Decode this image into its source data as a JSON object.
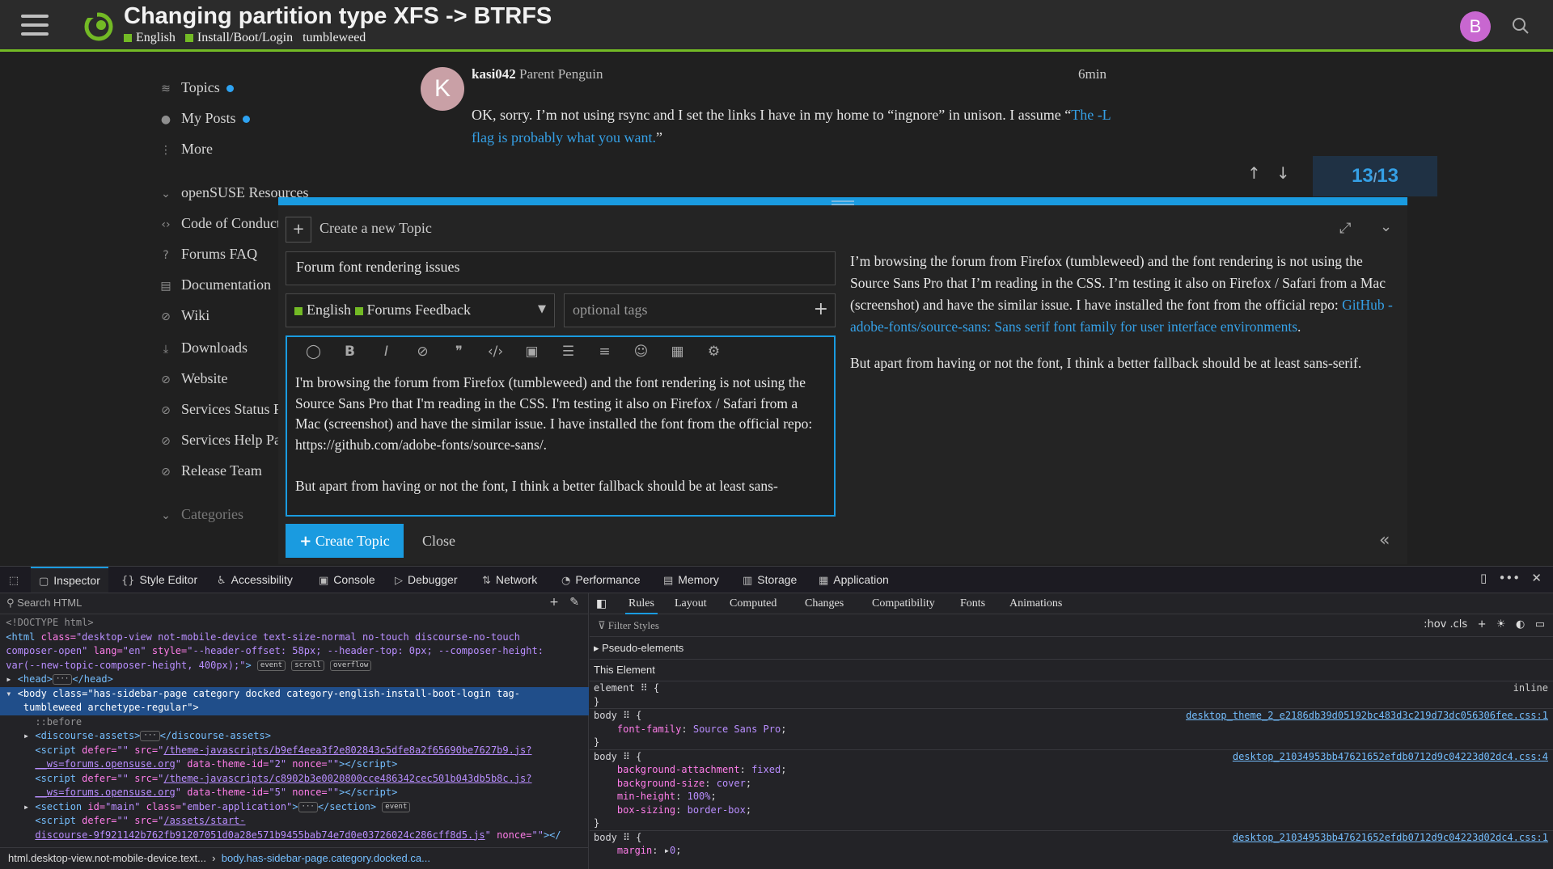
{
  "header": {
    "title": "Changing partition type XFS -> BTRFS",
    "breadcrumb": [
      "English",
      "Install/Boot/Login",
      "tumbleweed"
    ],
    "avatar_letter": "B",
    "accent_color": "#73ba25"
  },
  "sidebar": {
    "items": [
      {
        "icon": "layers-icon",
        "label": "Topics",
        "dot": true
      },
      {
        "icon": "user-icon",
        "label": "My Posts",
        "dot": true
      },
      {
        "icon": "more-icon",
        "label": "More"
      },
      {
        "icon": "chevron-down-icon",
        "label": "openSUSE Resources"
      },
      {
        "icon": "code-icon",
        "label": "Code of Conduct"
      },
      {
        "icon": "question-icon",
        "label": "Forums FAQ"
      },
      {
        "icon": "book-icon",
        "label": "Documentation"
      },
      {
        "icon": "link-icon",
        "label": "Wiki"
      },
      {
        "icon": "download-icon",
        "label": "Downloads"
      },
      {
        "icon": "link-icon",
        "label": "Website"
      },
      {
        "icon": "link-icon",
        "label": "Services Status Page"
      },
      {
        "icon": "link-icon",
        "label": "Services Help Page"
      },
      {
        "icon": "link-icon",
        "label": "Release Team"
      },
      {
        "icon": "chevron-down-icon",
        "label": "Categories"
      }
    ]
  },
  "post": {
    "avatar_letter": "K",
    "username": "kasi042",
    "user_title": "Parent Penguin",
    "time": "6min",
    "text_before": "OK, sorry. I’m not using rsync and I set the links I have in my home to “ingnore” in unison. I assume “",
    "link_text": "The -L flag is probably what you want.",
    "text_after": "”"
  },
  "progress": {
    "current": "13",
    "separator": "/",
    "total": "13"
  },
  "composer": {
    "new_topic_label": "Create a new Topic",
    "title_value": "Forum font rendering issues",
    "category_locale": "English",
    "category_name": "Forums Feedback",
    "tags_placeholder": "optional tags",
    "editor_text": "I'm browsing the forum from Firefox (tumbleweed) and the font rendering is not using the Source Sans Pro that I'm reading in the CSS. I'm testing it also on Firefox / Safari from a Mac (screenshot) and have the similar issue. I have installed the font from the official repo:\nhttps://github.com/adobe-fonts/source-sans/.\n\nBut apart from having or not the font, I think a better fallback should be at least sans-",
    "preview_p1": "I’m browsing the forum from Firefox (tumbleweed) and the font rendering is not using the Source Sans Pro that I’m reading in the CSS. I’m testing it also on Firefox / Safari from a Mac (screenshot) and have the similar issue. I have installed the font from the official repo: ",
    "preview_link": "GitHub - adobe-fonts/source-sans: Sans serif font family for user interface environments",
    "preview_p1_end": ".",
    "preview_p2": "But apart from having or not the font, I think a better fallback should be at least sans-serif.",
    "create_label": "Create Topic",
    "close_label": "Close",
    "accent_color": "#1a9be0"
  },
  "devtools": {
    "tabs": [
      "Inspector",
      "Style Editor",
      "Accessibility",
      "Console",
      "Debugger",
      "Network",
      "Performance",
      "Memory",
      "Storage",
      "Application"
    ],
    "search_placeholder": "Search HTML",
    "breadcrumb_1": "html.desktop-view.not-mobile-device.text...",
    "breadcrumb_2": "body.has-sidebar-page.category.docked.ca...",
    "rule_tabs": [
      "Rules",
      "Layout",
      "Computed",
      "Changes",
      "Compatibility",
      "Fonts",
      "Animations"
    ],
    "filter_placeholder": "Filter Styles",
    "filter_tools": ":hov .cls",
    "pseudo_label": "Pseudo-elements",
    "this_element_label": "This Element",
    "rule_element": "element",
    "rule_inline": "inline",
    "rule_body": "body",
    "src1": "desktop_theme_2_e2186db39d05192bc483d3c219d73dc056306fee.css:1",
    "src2": "desktop_21034953bb47621652efdb0712d9c04223d02dc4.css:4",
    "src3": "desktop_21034953bb47621652efdb0712d9c04223d02dc4.css:1",
    "decl_font_family": "font-family",
    "val_font_family": "Source Sans Pro",
    "decl_bg_att": "background-attachment",
    "val_bg_att": "fixed",
    "decl_bg_size": "background-size",
    "val_bg_size": "cover",
    "decl_min_height": "min-height",
    "val_min_height": "100%",
    "decl_box_sizing": "box-sizing",
    "val_box_sizing": "border-box",
    "decl_margin": "margin",
    "val_margin": "0"
  }
}
